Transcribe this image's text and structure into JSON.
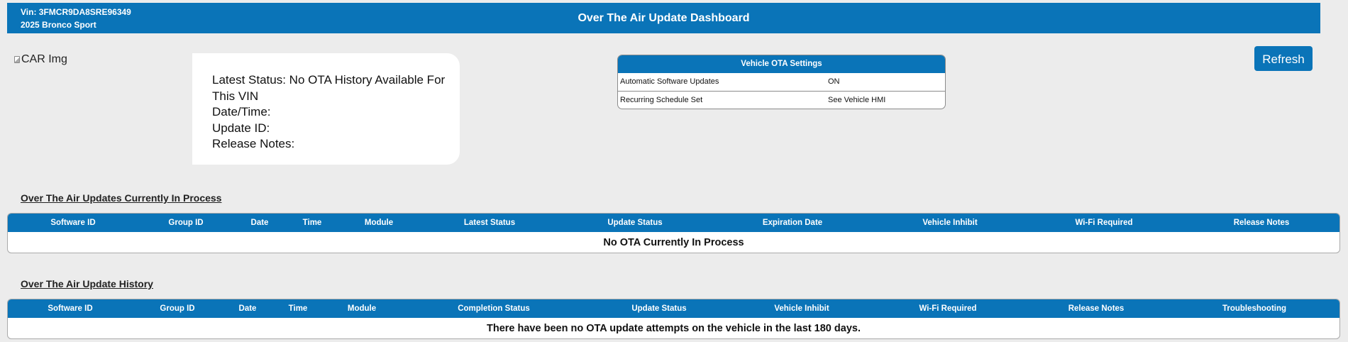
{
  "header": {
    "vin": "Vin: 3FMCR9DA8SRE96349",
    "model": "2025 Bronco Sport",
    "title": "Over The Air Update Dashboard"
  },
  "car_image": {
    "alt": "CAR Img"
  },
  "status_card": {
    "latest_status": "Latest Status: No OTA History Available For This VIN",
    "date_time": "Date/Time:",
    "update_id": "Update ID:",
    "release_notes": "Release Notes:"
  },
  "ota_settings": {
    "title": "Vehicle OTA Settings",
    "rows": [
      {
        "label": "Automatic Software Updates",
        "value": "ON"
      },
      {
        "label": "Recurring Schedule Set",
        "value": "See Vehicle HMI"
      }
    ]
  },
  "refresh_label": "Refresh",
  "in_process": {
    "title": "Over The Air Updates Currently In Process",
    "columns": [
      "Software ID",
      "Group ID",
      "Date",
      "Time",
      "Module",
      "Latest Status",
      "Update Status",
      "Expiration Date",
      "Vehicle Inhibit",
      "Wi-Fi Required",
      "Release Notes"
    ],
    "empty_message": "No OTA Currently In Process"
  },
  "history": {
    "title": "Over The Air Update History",
    "columns": [
      "Software ID",
      "Group ID",
      "Date",
      "Time",
      "Module",
      "Completion Status",
      "Update Status",
      "Vehicle Inhibit",
      "Wi-Fi Required",
      "Release Notes",
      "Troubleshooting"
    ],
    "empty_message": "There have been no OTA update attempts on the vehicle in the last 180 days."
  },
  "colors": {
    "brand_blue": "#0a74b8",
    "page_background": "#ececec"
  }
}
